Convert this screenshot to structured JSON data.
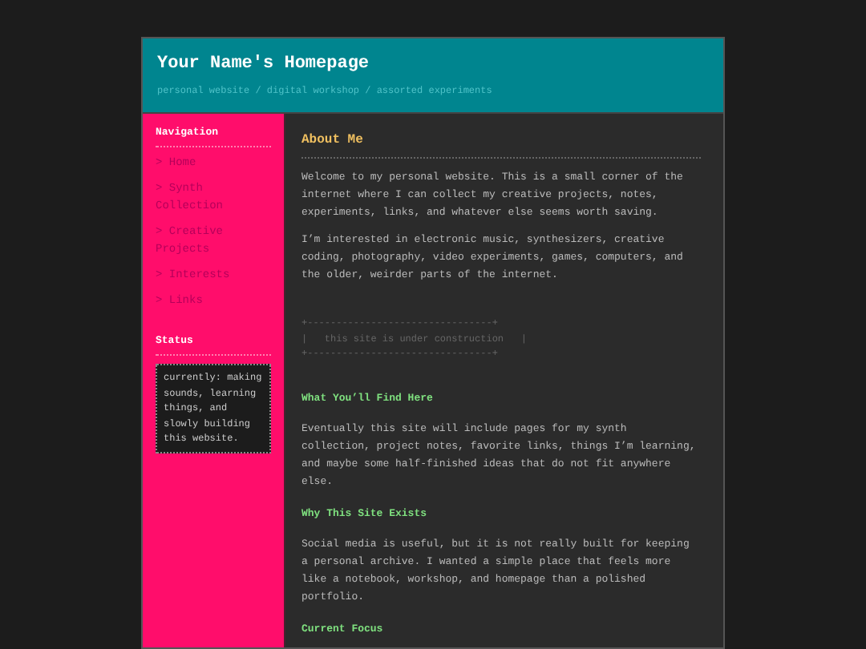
{
  "header": {
    "title": "Your Name's Homepage",
    "subtitle": "personal website / digital workshop / assorted experiments"
  },
  "sidebar": {
    "nav_title": "Navigation",
    "nav": [
      {
        "label": "> Home"
      },
      {
        "label": "> Synth Collection"
      },
      {
        "label": "> Creative Projects"
      },
      {
        "label": "> Interests"
      },
      {
        "label": "> Links"
      }
    ],
    "status_title": "Status",
    "status": "currently: making sounds, learning things, and slowly building this website."
  },
  "main": {
    "title": "About Me",
    "intro": [
      "Welcome to my personal website. This is a small corner of the internet where I can collect my creative projects, notes, experiments, links, and whatever else seems worth saving.",
      "I’m interested in electronic music, synthesizers, creative coding, photography, video experiments, games, computers, and the older, weirder parts of the internet."
    ],
    "construction": [
      "+--------------------------------+",
      "|   this site is under construction   |",
      "+--------------------------------+"
    ],
    "sections": [
      {
        "heading": "What You’ll Find Here",
        "text": "Eventually this site will include pages for my synth collection, project notes, favorite links, things I’m learning, and maybe some half-finished ideas that do not fit anywhere else."
      },
      {
        "heading": "Why This Site Exists",
        "text": "Social media is useful, but it is not really built for keeping a personal archive. I wanted a simple place that feels more like a notebook, workshop, and homepage than a polished portfolio."
      },
      {
        "heading": "Current Focus"
      }
    ]
  }
}
